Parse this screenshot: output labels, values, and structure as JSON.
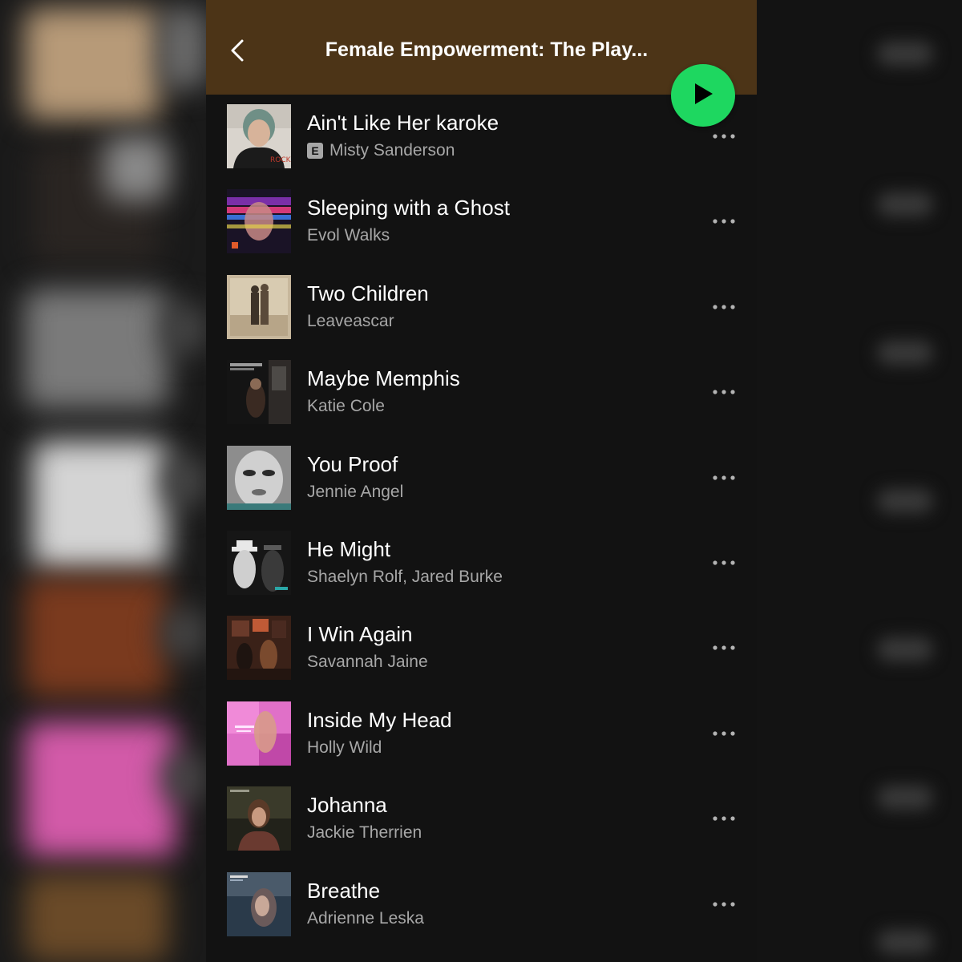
{
  "header": {
    "back_icon": "chevron-left-icon",
    "title": "Female Empowerment: The Play...",
    "background_color": "#4c3417",
    "play_icon": "play-icon",
    "play_color": "#1ed760"
  },
  "tracks": [
    {
      "title": "Ain't Like Her karoke",
      "artist": "Misty Sanderson",
      "explicit": true,
      "explicit_label": "E"
    },
    {
      "title": "Sleeping with a Ghost",
      "artist": "Evol Walks",
      "explicit": false
    },
    {
      "title": "Two Children",
      "artist": "Leaveascar",
      "explicit": false
    },
    {
      "title": "Maybe Memphis",
      "artist": "Katie Cole",
      "explicit": false
    },
    {
      "title": "You Proof",
      "artist": "Jennie Angel",
      "explicit": false
    },
    {
      "title": "He Might",
      "artist": "Shaelyn Rolf, Jared Burke",
      "explicit": false
    },
    {
      "title": "I Win Again",
      "artist": "Savannah Jaine",
      "explicit": false
    },
    {
      "title": "Inside My Head",
      "artist": "Holly Wild",
      "explicit": false
    },
    {
      "title": "Johanna",
      "artist": "Jackie Therrien",
      "explicit": false
    },
    {
      "title": "Breathe",
      "artist": "Adrienne Leska",
      "explicit": false
    }
  ],
  "more_icon": "more-options-icon",
  "colors": {
    "background": "#121212",
    "title_text": "#ffffff",
    "secondary_text": "#a7a7a7"
  }
}
